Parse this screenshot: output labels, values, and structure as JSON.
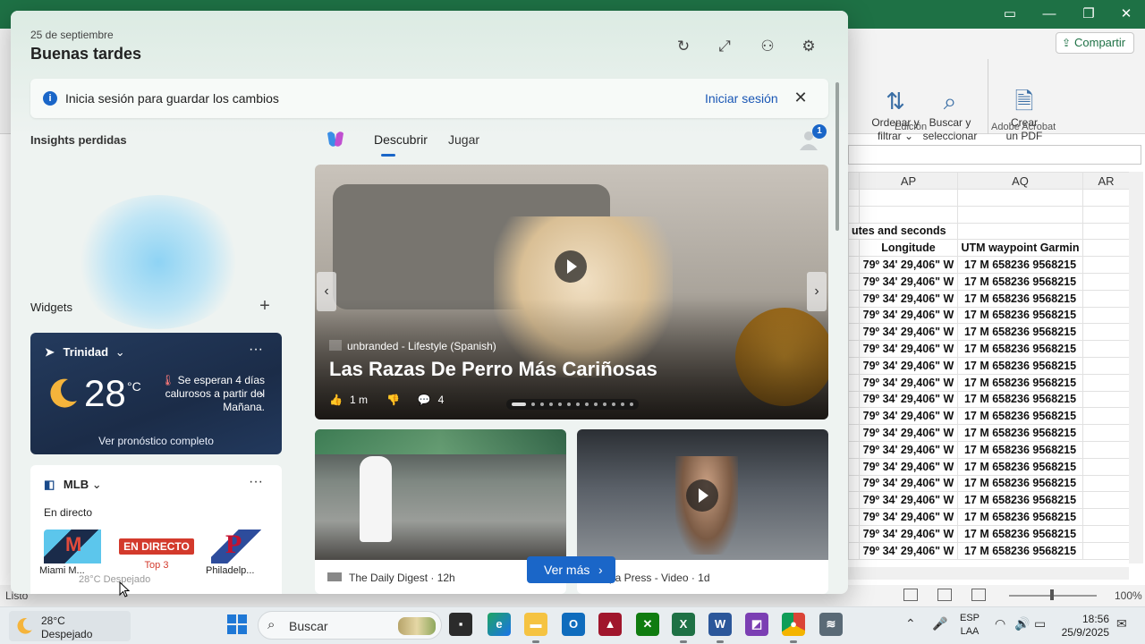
{
  "excel": {
    "share_label": "Compartir",
    "ribbon": {
      "sort_filter_label": "Ordenar y",
      "sort_filter_label2": "filtrar",
      "find_select_label": "Buscar y",
      "find_select_label2": "seleccionar",
      "create_pdf_label": "Crear",
      "create_pdf_label2": "un PDF",
      "group_edit": "Edición",
      "group_acrobat": "Adobe Acrobat"
    },
    "columns": [
      "AP",
      "AQ",
      "AR"
    ],
    "merged_header": "utes and seconds",
    "col_headers": [
      "Longitude",
      "UTM waypoint Garmin"
    ],
    "rows": [
      [
        "79º 34' 29,406\" W",
        "17 M 658236 9568215"
      ],
      [
        "79º 34' 29,406\" W",
        "17 M 658236 9568215"
      ],
      [
        "79º 34' 29,406\" W",
        "17 M 658236 9568215"
      ],
      [
        "79º 34' 29,406\" W",
        "17 M 658236 9568215"
      ],
      [
        "79º 34' 29,406\" W",
        "17 M 658236 9568215"
      ],
      [
        "79º 34' 29,406\" W",
        "17 M 658236 9568215"
      ],
      [
        "79º 34' 29,406\" W",
        "17 M 658236 9568215"
      ],
      [
        "79º 34' 29,406\" W",
        "17 M 658236 9568215"
      ],
      [
        "79º 34' 29,406\" W",
        "17 M 658236 9568215"
      ],
      [
        "79º 34' 29,406\" W",
        "17 M 658236 9568215"
      ],
      [
        "79º 34' 29,406\" W",
        "17 M 658236 9568215"
      ],
      [
        "79º 34' 29,406\" W",
        "17 M 658236 9568215"
      ],
      [
        "79º 34' 29,406\" W",
        "17 M 658236 9568215"
      ],
      [
        "79º 34' 29,406\" W",
        "17 M 658236 9568215"
      ],
      [
        "79º 34' 29,406\" W",
        "17 M 658236 9568215"
      ],
      [
        "79º 34' 29,406\" W",
        "17 M 658236 9568215"
      ],
      [
        "79º 34' 29,406\" W",
        "17 M 658236 9568215"
      ],
      [
        "79º 34' 29,406\" W",
        "17 M 658236 9568215"
      ]
    ],
    "status_ready": "Listo",
    "zoom_level": "100%"
  },
  "widgets": {
    "date": "25 de septiembre",
    "greeting": "Buenas tardes",
    "header_icons": [
      "refresh-icon",
      "expand-icon",
      "widgets-icon",
      "gear-icon"
    ],
    "signin_message": "Inicia sesión para guardar los cambios",
    "signin_link": "Iniciar sesión",
    "insights_title": "Insights perdidas",
    "widgets_title": "Widgets",
    "weather": {
      "location": "Trinidad",
      "temperature": "28",
      "unit": "°C",
      "alert": "Se esperan 4 días calurosos a partir del Mañana.",
      "full_forecast": "Ver pronóstico completo"
    },
    "mlb": {
      "title": "MLB",
      "live_label": "En directo",
      "live_badge": "EN DIRECTO",
      "inning": "Top 3",
      "team_a": "Miami M...",
      "team_b": "Philadelp..."
    },
    "tabs": [
      {
        "label": "Descubrir",
        "active": true
      },
      {
        "label": "Jugar",
        "active": false
      }
    ],
    "notification_count": "1",
    "hero": {
      "source": "unbranded - Lifestyle (Spanish)",
      "headline": "Las Razas De Perro Más Cariñosas",
      "likes": "1 m",
      "comments": "4"
    },
    "cards": [
      {
        "source": "The Daily Digest",
        "age": "12h"
      },
      {
        "source": "pa Press - Video",
        "age": "1d"
      }
    ],
    "see_more": "Ver más",
    "tooltip": "28°C Despejado"
  },
  "taskbar": {
    "weather_temp": "28°C",
    "weather_cond": "Despejado",
    "search_placeholder": "Buscar",
    "language": "ESP",
    "layout": "LAA",
    "time": "18:56",
    "date": "25/9/2025"
  },
  "colors": {
    "excel_green": "#1e7145",
    "accent_blue": "#1a66c8",
    "live_red": "#d33a2c"
  }
}
